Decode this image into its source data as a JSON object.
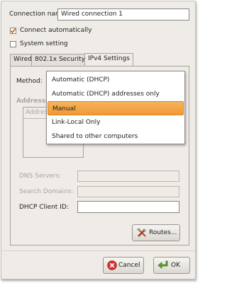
{
  "connection_name": {
    "label": "Connection name:",
    "value": "Wired connection 1"
  },
  "options": {
    "connect_automatically": {
      "label": "Connect automatically",
      "checked": true
    },
    "system_setting": {
      "label": "System setting",
      "checked": false
    }
  },
  "tabs": [
    {
      "label": "Wired"
    },
    {
      "label": "802.1x Security"
    },
    {
      "label": "IPv4 Settings"
    }
  ],
  "method": {
    "label": "Method:"
  },
  "addresses": {
    "label": "Addresses",
    "column_label": "Address"
  },
  "fields": {
    "dns_servers": {
      "label": "DNS Servers:"
    },
    "search_domains": {
      "label": "Search Domains:"
    },
    "dhcp_client_id": {
      "label": "DHCP Client ID:"
    }
  },
  "routes_button": {
    "label": "Routes..."
  },
  "dropdown": {
    "items": [
      "Automatic (DHCP)",
      "Automatic (DHCP) addresses only",
      "Manual",
      "Link-Local Only",
      "Shared to other computers"
    ],
    "selected": "Manual"
  },
  "buttons": {
    "cancel": "Cancel",
    "ok": "OK"
  },
  "colors": {
    "highlight": "#ef9a35",
    "dialog_bg": "#efebe7"
  }
}
